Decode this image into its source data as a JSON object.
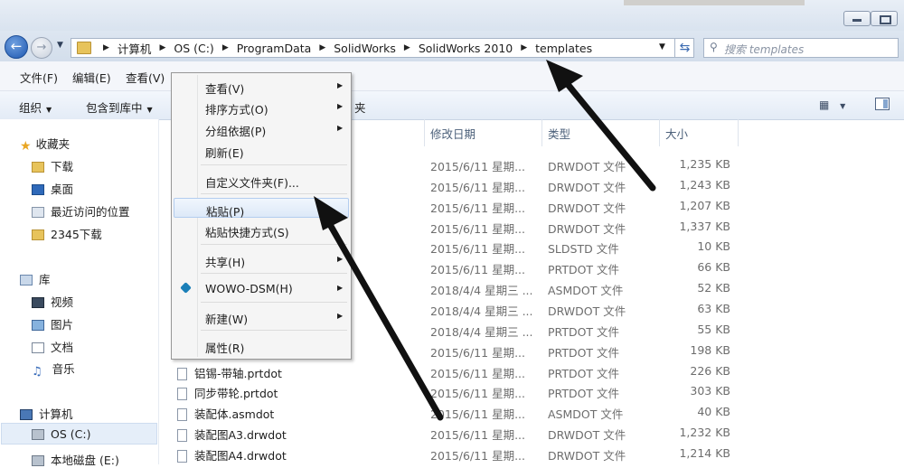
{
  "address_bar": {
    "crumbs": [
      "计算机",
      "OS (C:)",
      "ProgramData",
      "SolidWorks",
      "SolidWorks 2010",
      "templates"
    ],
    "search_placeholder": "搜索 templates"
  },
  "menu_bar": [
    "文件(F)",
    "编辑(E)",
    "查看(V)"
  ],
  "command_bar": {
    "organize": "组织",
    "include_in_library": "包含到库中",
    "new_folder_fragment": "夹"
  },
  "nav_pane": {
    "favorites": "收藏夹",
    "fav_items": [
      "下载",
      "桌面",
      "最近访问的位置",
      "2345下载"
    ],
    "libraries": "库",
    "lib_items": [
      "视频",
      "图片",
      "文档",
      "音乐"
    ],
    "computer": "计算机",
    "drives": [
      "OS (C:)",
      "本地磁盘 (E:)"
    ]
  },
  "columns": {
    "date": "修改日期",
    "type": "类型",
    "size": "大小"
  },
  "files": [
    {
      "name": "",
      "date": "2015/6/11 星期...",
      "type": "DRWDOT 文件",
      "size": "1,235 KB"
    },
    {
      "name": "",
      "date": "2015/6/11 星期...",
      "type": "DRWDOT 文件",
      "size": "1,243 KB"
    },
    {
      "name": "",
      "date": "2015/6/11 星期...",
      "type": "DRWDOT 文件",
      "size": "1,207 KB"
    },
    {
      "name": "",
      "date": "2015/6/11 星期...",
      "type": "DRWDOT 文件",
      "size": "1,337 KB"
    },
    {
      "name": "",
      "date": "2015/6/11 星期...",
      "type": "SLDSTD 文件",
      "size": "10 KB"
    },
    {
      "name": "",
      "date": "2015/6/11 星期...",
      "type": "PRTDOT 文件",
      "size": "66 KB"
    },
    {
      "name": "",
      "date": "2018/4/4 星期三 ...",
      "type": "ASMDOT 文件",
      "size": "52 KB"
    },
    {
      "name": "",
      "date": "2018/4/4 星期三 ...",
      "type": "DRWDOT 文件",
      "size": "63 KB"
    },
    {
      "name": "",
      "date": "2018/4/4 星期三 ...",
      "type": "PRTDOT 文件",
      "size": "55 KB"
    },
    {
      "name": "",
      "date": "2015/6/11 星期...",
      "type": "PRTDOT 文件",
      "size": "198 KB"
    },
    {
      "name": "铝锡-带轴.prtdot",
      "date": "2015/6/11 星期...",
      "type": "PRTDOT 文件",
      "size": "226 KB"
    },
    {
      "name": "同步带轮.prtdot",
      "date": "2015/6/11 星期...",
      "type": "PRTDOT 文件",
      "size": "303 KB"
    },
    {
      "name": "装配体.asmdot",
      "date": "2015/6/11 星期...",
      "type": "ASMDOT 文件",
      "size": "40 KB"
    },
    {
      "name": "装配图A3.drwdot",
      "date": "2015/6/11 星期...",
      "type": "DRWDOT 文件",
      "size": "1,232 KB"
    },
    {
      "name": "装配图A4.drwdot",
      "date": "2015/6/11 星期...",
      "type": "DRWDOT 文件",
      "size": "1,214 KB"
    }
  ],
  "context_menu": {
    "view": "查看(V)",
    "sort_by": "排序方式(O)",
    "group_by": "分组依据(P)",
    "refresh": "刷新(E)",
    "customize": "自定义文件夹(F)...",
    "paste": "粘贴(P)",
    "paste_shortcut": "粘贴快捷方式(S)",
    "share": "共享(H)",
    "wowo": "WOWO-DSM(H)",
    "new": "新建(W)",
    "properties": "属性(R)"
  },
  "colors": {
    "accent": "#3a6ab1",
    "highlight": "#dde9f8",
    "folder": "#e7c35b"
  }
}
